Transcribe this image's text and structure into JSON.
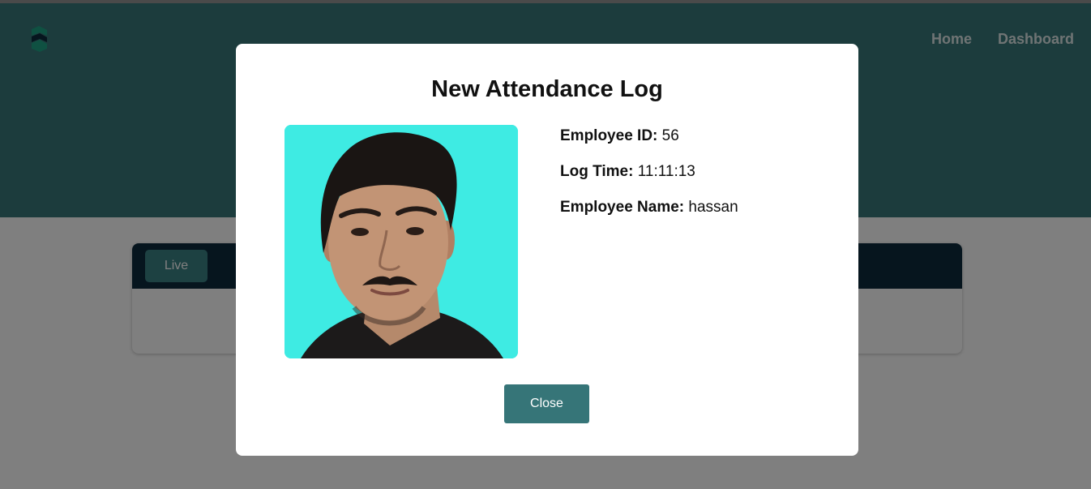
{
  "nav": {
    "items": [
      "Home",
      "Dashboard"
    ]
  },
  "card": {
    "tab_label": "Live"
  },
  "modal": {
    "title": "New Attendance Log",
    "fields": [
      {
        "label": "Employee ID:",
        "value": "56"
      },
      {
        "label": "Log Time:",
        "value": "11:11:13"
      },
      {
        "label": "Employee Name:",
        "value": "hassan"
      }
    ],
    "close_label": "Close"
  },
  "colors": {
    "header": "#39797a",
    "accent": "#367578",
    "card_header": "#0d2b3d",
    "photo_background": "#3eebe3"
  },
  "icons": {
    "logo": "brand-logo-icon"
  }
}
